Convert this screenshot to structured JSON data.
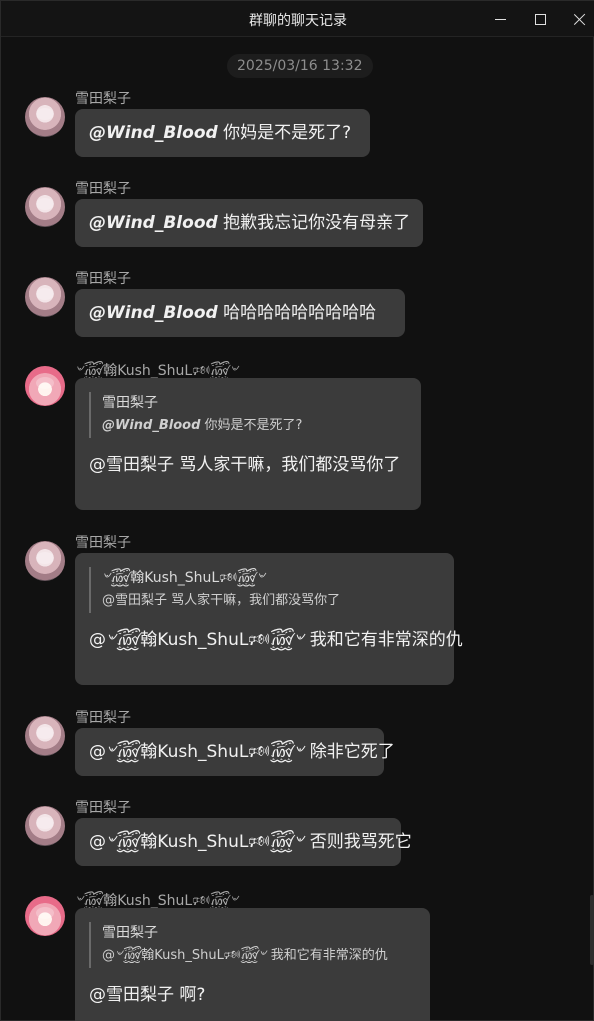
{
  "window": {
    "title": "群聊的聊天记录"
  },
  "timestamp": "2025/03/16 13:32",
  "messages": [
    {
      "sender": "雪田梨子",
      "mention": "@Wind_Blood",
      "text": " 你妈是不是死了?"
    },
    {
      "sender": "雪田梨子",
      "mention": "@Wind_Blood",
      "text": " 抱歉我忘记你没有母亲了"
    },
    {
      "sender": "雪田梨子",
      "mention": "@Wind_Blood",
      "text": " 哈哈哈哈哈哈哈哈哈"
    },
    {
      "sender": "৺꫞翰Kush_ShuL🕬꫞৺",
      "quote_sender": "雪田梨子",
      "quote_mention": "@Wind_Blood",
      "quote_text": " 你妈是不是死了?",
      "text": "@雪田梨子 骂人家干嘛，我们都没骂你了"
    },
    {
      "sender": "雪田梨子",
      "quote_sender": "৺꫞翰Kush_ShuL🕬꫞৺",
      "quote_text": "@雪田梨子 骂人家干嘛，我们都没骂你了",
      "text": "@৺꫞翰Kush_ShuL🕬꫞৺ 我和它有非常深的仇"
    },
    {
      "sender": "雪田梨子",
      "text": "@৺꫞翰Kush_ShuL🕬꫞৺ 除非它死了"
    },
    {
      "sender": "雪田梨子",
      "text": "@৺꫞翰Kush_ShuL🕬꫞৺ 否则我骂死它"
    },
    {
      "sender": "৺꫞翰Kush_ShuL🕬꫞৺",
      "quote_sender": "雪田梨子",
      "quote_text": "@৺꫞翰Kush_ShuL🕬꫞৺ 我和它有非常深的仇",
      "text": "@雪田梨子 啊?"
    }
  ],
  "icons": {
    "minimize": "minimize-icon",
    "maximize": "maximize-icon",
    "close": "close-icon",
    "avatar_1": "avatar-icon",
    "avatar_2": "avatar-icon"
  },
  "colors": {
    "background": "#111111",
    "bubble": "#3b3b3b",
    "sender": "#a8a8a8",
    "text": "#f1f1f1"
  }
}
